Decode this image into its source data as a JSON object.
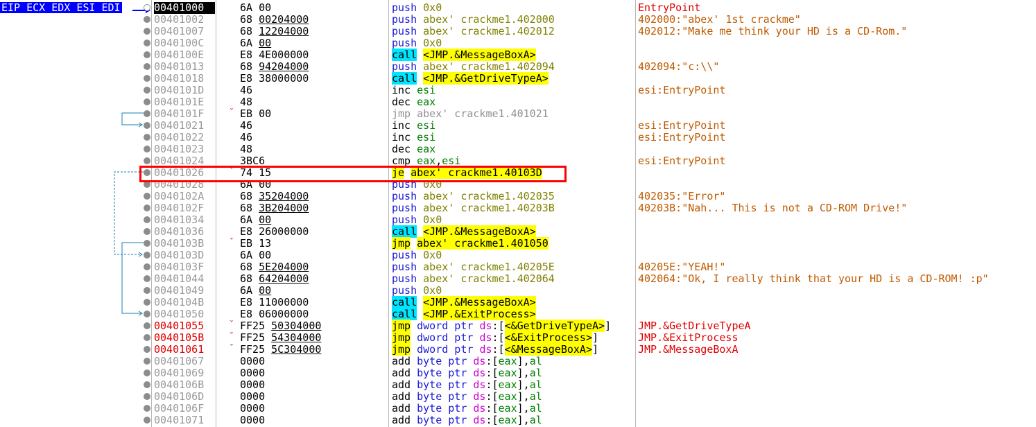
{
  "registers_label": "EIP ECX EDX ESI EDI",
  "rows": [
    {
      "addr": "00401000",
      "bytes": "6A 00",
      "op1": "",
      "jump": false,
      "addr_style": "cur",
      "dis": [
        {
          "t": "push",
          "c": "mn"
        },
        {
          "t": " "
        },
        {
          "t": "0x0",
          "c": "olive"
        }
      ],
      "comment": "EntryPoint",
      "comment_style": "red"
    },
    {
      "addr": "00401002",
      "bytes": "68 ",
      "op1": "00204000",
      "jump": false,
      "dis": [
        {
          "t": "push",
          "c": "mn"
        },
        {
          "t": " "
        },
        {
          "t": "abex' crackme1.402000",
          "c": "olive"
        }
      ],
      "comment": "402000:\"abex' 1st crackme\""
    },
    {
      "addr": "00401007",
      "bytes": "68 ",
      "op1": "12204000",
      "jump": false,
      "dis": [
        {
          "t": "push",
          "c": "mn"
        },
        {
          "t": " "
        },
        {
          "t": "abex' crackme1.402012",
          "c": "olive"
        }
      ],
      "comment": "402012:\"Make me think your HD is a CD-Rom.\""
    },
    {
      "addr": "0040100C",
      "bytes": "6A ",
      "op1": "00",
      "jump": false,
      "dis": [
        {
          "t": "push",
          "c": "mn"
        },
        {
          "t": " "
        },
        {
          "t": "0x0",
          "c": "olive"
        }
      ],
      "comment": ""
    },
    {
      "addr": "0040100E",
      "bytes": "E8 4E000000",
      "op1": "",
      "jump": false,
      "dis": [
        {
          "t": "call",
          "c": "mn callhl"
        },
        {
          "t": " "
        },
        {
          "t": "<JMP.&MessageBoxA>",
          "c": "yel"
        }
      ],
      "comment": ""
    },
    {
      "addr": "00401013",
      "bytes": "68 ",
      "op1": "94204000",
      "jump": false,
      "dis": [
        {
          "t": "push",
          "c": "mn"
        },
        {
          "t": " "
        },
        {
          "t": "abex' crackme1.402094",
          "c": "olive"
        }
      ],
      "comment": "402094:\"c:\\\\\""
    },
    {
      "addr": "00401018",
      "bytes": "E8 38000000",
      "op1": "",
      "jump": false,
      "dis": [
        {
          "t": "call",
          "c": "mn callhl"
        },
        {
          "t": " "
        },
        {
          "t": "<JMP.&GetDriveTypeA>",
          "c": "yel"
        }
      ],
      "comment": ""
    },
    {
      "addr": "0040101D",
      "bytes": "46",
      "op1": "",
      "jump": false,
      "dis": [
        {
          "t": "inc",
          "c": "mn plain"
        },
        {
          "t": " "
        },
        {
          "t": "esi",
          "c": "grn"
        }
      ],
      "comment": "esi:EntryPoint"
    },
    {
      "addr": "0040101E",
      "bytes": "48",
      "op1": "",
      "jump": false,
      "dis": [
        {
          "t": "dec",
          "c": "mn plain"
        },
        {
          "t": " "
        },
        {
          "t": "eax",
          "c": "grn"
        }
      ],
      "comment": ""
    },
    {
      "addr": "0040101F",
      "bytes": "EB 00",
      "op1": "",
      "jump": true,
      "dis": [
        {
          "t": "jmp abex' crackme1.401021",
          "c": "mn gray"
        }
      ],
      "comment": ""
    },
    {
      "addr": "00401021",
      "bytes": "46",
      "op1": "",
      "jump": false,
      "dis": [
        {
          "t": "inc",
          "c": "mn plain"
        },
        {
          "t": " "
        },
        {
          "t": "esi",
          "c": "grn"
        }
      ],
      "comment": "esi:EntryPoint"
    },
    {
      "addr": "00401022",
      "bytes": "46",
      "op1": "",
      "jump": false,
      "dis": [
        {
          "t": "inc",
          "c": "mn plain"
        },
        {
          "t": " "
        },
        {
          "t": "esi",
          "c": "grn"
        }
      ],
      "comment": "esi:EntryPoint"
    },
    {
      "addr": "00401023",
      "bytes": "48",
      "op1": "",
      "jump": false,
      "dis": [
        {
          "t": "dec",
          "c": "mn plain"
        },
        {
          "t": " "
        },
        {
          "t": "eax",
          "c": "grn"
        }
      ],
      "comment": ""
    },
    {
      "addr": "00401024",
      "bytes": "3BC6",
      "op1": "",
      "jump": false,
      "dis": [
        {
          "t": "cmp",
          "c": "mn plain"
        },
        {
          "t": " "
        },
        {
          "t": "eax",
          "c": "grn"
        },
        {
          "t": ",",
          "c": "pun"
        },
        {
          "t": "esi",
          "c": "grn"
        }
      ],
      "comment": "esi:EntryPoint"
    },
    {
      "addr": "00401026",
      "bytes": "74 15",
      "op1": "",
      "jump": true,
      "dis": [
        {
          "t": "je",
          "c": "mn jmphl"
        },
        {
          "t": " "
        },
        {
          "t": "abex' crackme1.40103D",
          "c": "yel"
        }
      ],
      "comment": ""
    },
    {
      "addr": "00401028",
      "bytes": "6A 00",
      "op1": "",
      "jump": false,
      "dis": [
        {
          "t": "push",
          "c": "mn"
        },
        {
          "t": " "
        },
        {
          "t": "0x0",
          "c": "olive"
        }
      ],
      "comment": ""
    },
    {
      "addr": "0040102A",
      "bytes": "68 ",
      "op1": "35204000",
      "jump": false,
      "dis": [
        {
          "t": "push",
          "c": "mn"
        },
        {
          "t": " "
        },
        {
          "t": "abex' crackme1.402035",
          "c": "olive"
        }
      ],
      "comment": "402035:\"Error\""
    },
    {
      "addr": "0040102F",
      "bytes": "68 ",
      "op1": "3B204000",
      "jump": false,
      "dis": [
        {
          "t": "push",
          "c": "mn"
        },
        {
          "t": " "
        },
        {
          "t": "abex' crackme1.40203B",
          "c": "olive"
        }
      ],
      "comment": "40203B:\"Nah... This is not a CD-ROM Drive!\""
    },
    {
      "addr": "00401034",
      "bytes": "6A ",
      "op1": "00",
      "jump": false,
      "dis": [
        {
          "t": "push",
          "c": "mn"
        },
        {
          "t": " "
        },
        {
          "t": "0x0",
          "c": "olive"
        }
      ],
      "comment": ""
    },
    {
      "addr": "00401036",
      "bytes": "E8 26000000",
      "op1": "",
      "jump": false,
      "dis": [
        {
          "t": "call",
          "c": "mn callhl"
        },
        {
          "t": " "
        },
        {
          "t": "<JMP.&MessageBoxA>",
          "c": "yel"
        }
      ],
      "comment": ""
    },
    {
      "addr": "0040103B",
      "bytes": "EB 13",
      "op1": "",
      "jump": true,
      "dis": [
        {
          "t": "jmp",
          "c": "mn jmphl"
        },
        {
          "t": " "
        },
        {
          "t": "abex' crackme1.401050",
          "c": "yel"
        }
      ],
      "comment": ""
    },
    {
      "addr": "0040103D",
      "bytes": "6A 00",
      "op1": "",
      "jump": false,
      "dis": [
        {
          "t": "push",
          "c": "mn"
        },
        {
          "t": " "
        },
        {
          "t": "0x0",
          "c": "olive"
        }
      ],
      "comment": ""
    },
    {
      "addr": "0040103F",
      "bytes": "68 ",
      "op1": "5E204000",
      "jump": false,
      "dis": [
        {
          "t": "push",
          "c": "mn"
        },
        {
          "t": " "
        },
        {
          "t": "abex' crackme1.40205E",
          "c": "olive"
        }
      ],
      "comment": "40205E:\"YEAH!\""
    },
    {
      "addr": "00401044",
      "bytes": "68 ",
      "op1": "64204000",
      "jump": false,
      "dis": [
        {
          "t": "push",
          "c": "mn"
        },
        {
          "t": " "
        },
        {
          "t": "abex' crackme1.402064",
          "c": "olive"
        }
      ],
      "comment": "402064:\"Ok, I really think that your HD is a CD-ROM! :p\""
    },
    {
      "addr": "00401049",
      "bytes": "6A ",
      "op1": "00",
      "jump": false,
      "dis": [
        {
          "t": "push",
          "c": "mn"
        },
        {
          "t": " "
        },
        {
          "t": "0x0",
          "c": "olive"
        }
      ],
      "comment": ""
    },
    {
      "addr": "0040104B",
      "bytes": "E8 11000000",
      "op1": "",
      "jump": false,
      "dis": [
        {
          "t": "call",
          "c": "mn callhl"
        },
        {
          "t": " "
        },
        {
          "t": "<JMP.&MessageBoxA>",
          "c": "yel"
        }
      ],
      "comment": ""
    },
    {
      "addr": "00401050",
      "bytes": "E8 06000000",
      "op1": "",
      "jump": false,
      "dis": [
        {
          "t": "call",
          "c": "mn callhl"
        },
        {
          "t": " "
        },
        {
          "t": "<JMP.&ExitProcess>",
          "c": "yel"
        }
      ],
      "comment": ""
    },
    {
      "addr": "00401055",
      "bytes": "FF25 ",
      "op1": "50304000",
      "jump": true,
      "addr_style": "red",
      "dis": [
        {
          "t": "jmp",
          "c": "mn jmphl"
        },
        {
          "t": " "
        },
        {
          "t": "dword ptr",
          "c": "mn"
        },
        {
          "t": " "
        },
        {
          "t": "ds",
          "c": "mag"
        },
        {
          "t": ":[",
          "c": "pun"
        },
        {
          "t": "<&GetDriveTypeA>",
          "c": "yel"
        },
        {
          "t": "]",
          "c": "pun"
        }
      ],
      "comment": "JMP.&GetDriveTypeA",
      "comment_style": "red"
    },
    {
      "addr": "0040105B",
      "bytes": "FF25 ",
      "op1": "54304000",
      "jump": true,
      "addr_style": "red",
      "dis": [
        {
          "t": "jmp",
          "c": "mn jmphl"
        },
        {
          "t": " "
        },
        {
          "t": "dword ptr",
          "c": "mn"
        },
        {
          "t": " "
        },
        {
          "t": "ds",
          "c": "mag"
        },
        {
          "t": ":[",
          "c": "pun"
        },
        {
          "t": "<&ExitProcess>",
          "c": "yel"
        },
        {
          "t": "]",
          "c": "pun"
        }
      ],
      "comment": "JMP.&ExitProcess",
      "comment_style": "red"
    },
    {
      "addr": "00401061",
      "bytes": "FF25 ",
      "op1": "5C304000",
      "jump": true,
      "addr_style": "red",
      "dis": [
        {
          "t": "jmp",
          "c": "mn jmphl"
        },
        {
          "t": " "
        },
        {
          "t": "dword ptr",
          "c": "mn"
        },
        {
          "t": " "
        },
        {
          "t": "ds",
          "c": "mag"
        },
        {
          "t": ":[",
          "c": "pun"
        },
        {
          "t": "<&MessageBoxA>",
          "c": "yel"
        },
        {
          "t": "]",
          "c": "pun"
        }
      ],
      "comment": "JMP.&MessageBoxA",
      "comment_style": "red"
    },
    {
      "addr": "00401067",
      "bytes": "0000",
      "op1": "",
      "jump": false,
      "dis": [
        {
          "t": "add",
          "c": "mn plain"
        },
        {
          "t": " "
        },
        {
          "t": "byte ptr",
          "c": "mn"
        },
        {
          "t": " "
        },
        {
          "t": "ds",
          "c": "mag"
        },
        {
          "t": ":[",
          "c": "pun"
        },
        {
          "t": "eax",
          "c": "grn"
        },
        {
          "t": "],",
          "c": "pun"
        },
        {
          "t": "al",
          "c": "grn"
        }
      ],
      "comment": ""
    },
    {
      "addr": "00401069",
      "bytes": "0000",
      "op1": "",
      "jump": false,
      "dis": [
        {
          "t": "add",
          "c": "mn plain"
        },
        {
          "t": " "
        },
        {
          "t": "byte ptr",
          "c": "mn"
        },
        {
          "t": " "
        },
        {
          "t": "ds",
          "c": "mag"
        },
        {
          "t": ":[",
          "c": "pun"
        },
        {
          "t": "eax",
          "c": "grn"
        },
        {
          "t": "],",
          "c": "pun"
        },
        {
          "t": "al",
          "c": "grn"
        }
      ],
      "comment": ""
    },
    {
      "addr": "0040106B",
      "bytes": "0000",
      "op1": "",
      "jump": false,
      "dis": [
        {
          "t": "add",
          "c": "mn plain"
        },
        {
          "t": " "
        },
        {
          "t": "byte ptr",
          "c": "mn"
        },
        {
          "t": " "
        },
        {
          "t": "ds",
          "c": "mag"
        },
        {
          "t": ":[",
          "c": "pun"
        },
        {
          "t": "eax",
          "c": "grn"
        },
        {
          "t": "],",
          "c": "pun"
        },
        {
          "t": "al",
          "c": "grn"
        }
      ],
      "comment": ""
    },
    {
      "addr": "0040106D",
      "bytes": "0000",
      "op1": "",
      "jump": false,
      "dis": [
        {
          "t": "add",
          "c": "mn plain"
        },
        {
          "t": " "
        },
        {
          "t": "byte ptr",
          "c": "mn"
        },
        {
          "t": " "
        },
        {
          "t": "ds",
          "c": "mag"
        },
        {
          "t": ":[",
          "c": "pun"
        },
        {
          "t": "eax",
          "c": "grn"
        },
        {
          "t": "],",
          "c": "pun"
        },
        {
          "t": "al",
          "c": "grn"
        }
      ],
      "comment": ""
    },
    {
      "addr": "0040106F",
      "bytes": "0000",
      "op1": "",
      "jump": false,
      "dis": [
        {
          "t": "add",
          "c": "mn plain"
        },
        {
          "t": " "
        },
        {
          "t": "byte ptr",
          "c": "mn"
        },
        {
          "t": " "
        },
        {
          "t": "ds",
          "c": "mag"
        },
        {
          "t": ":[",
          "c": "pun"
        },
        {
          "t": "eax",
          "c": "grn"
        },
        {
          "t": "],",
          "c": "pun"
        },
        {
          "t": "al",
          "c": "grn"
        }
      ],
      "comment": ""
    },
    {
      "addr": "00401071",
      "bytes": "0000",
      "op1": "",
      "jump": false,
      "dis": [
        {
          "t": "add",
          "c": "mn plain"
        },
        {
          "t": " "
        },
        {
          "t": "byte ptr",
          "c": "mn"
        },
        {
          "t": " "
        },
        {
          "t": "ds",
          "c": "mag"
        },
        {
          "t": ":[",
          "c": "pun"
        },
        {
          "t": "eax",
          "c": "grn"
        },
        {
          "t": "],",
          "c": "pun"
        },
        {
          "t": "al",
          "c": "grn"
        }
      ],
      "comment": ""
    }
  ]
}
